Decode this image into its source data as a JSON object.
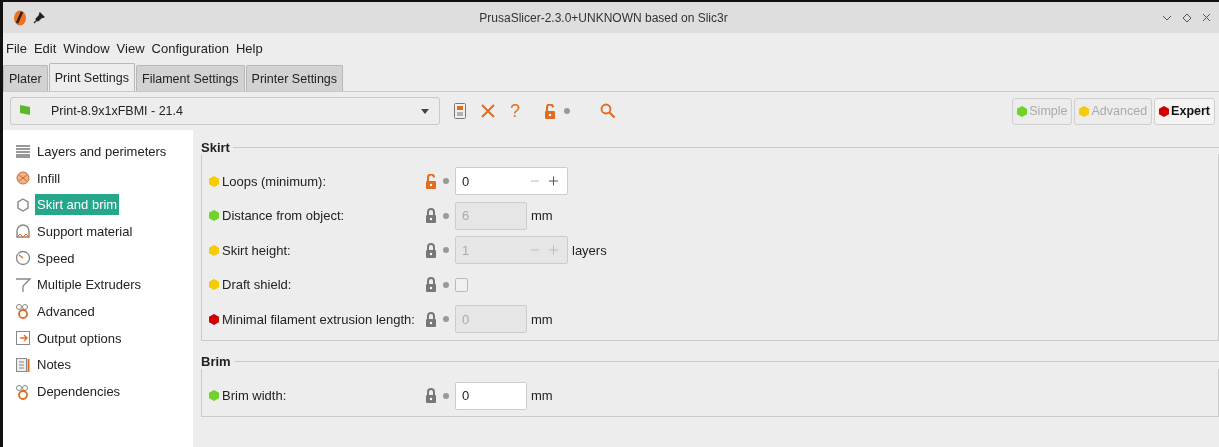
{
  "window": {
    "title": "PrusaSlicer-2.3.0+UNKNOWN based on Slic3r"
  },
  "menu": [
    "File",
    "Edit",
    "Window",
    "View",
    "Configuration",
    "Help"
  ],
  "tabs": [
    {
      "label": "Plater",
      "selected": false
    },
    {
      "label": "Print Settings",
      "selected": true
    },
    {
      "label": "Filament Settings",
      "selected": false
    },
    {
      "label": "Printer Settings",
      "selected": false
    }
  ],
  "preset": {
    "value": "Print-8.9x1xFBMI - 21.4",
    "toolbar_icon_glyph": "?"
  },
  "modes": [
    {
      "label": "Simple",
      "color": "#6fd32a",
      "selected": false
    },
    {
      "label": "Advanced",
      "color": "#f5cc00",
      "selected": false
    },
    {
      "label": "Expert",
      "color": "#d40000",
      "selected": true
    }
  ],
  "sidebar": [
    {
      "label": "Layers and perimeters",
      "selected": false
    },
    {
      "label": "Infill",
      "selected": false
    },
    {
      "label": "Skirt and brim",
      "selected": true
    },
    {
      "label": "Support material",
      "selected": false
    },
    {
      "label": "Speed",
      "selected": false
    },
    {
      "label": "Multiple Extruders",
      "selected": false
    },
    {
      "label": "Advanced",
      "selected": false
    },
    {
      "label": "Output options",
      "selected": false
    },
    {
      "label": "Notes",
      "selected": false
    },
    {
      "label": "Dependencies",
      "selected": false
    }
  ],
  "groups": [
    {
      "title": "Skirt",
      "options": [
        {
          "label": "Loops (minimum):",
          "color": "#f5cc00",
          "locked": false,
          "kind": "spin",
          "value": "0",
          "disabled": false
        },
        {
          "label": "Distance from object:",
          "color": "#6fd32a",
          "locked": true,
          "kind": "number",
          "value": "6",
          "disabled": true,
          "unit": "mm"
        },
        {
          "label": "Skirt height:",
          "color": "#f5cc00",
          "locked": true,
          "kind": "spin",
          "value": "1",
          "disabled": true,
          "unit": "layers"
        },
        {
          "label": "Draft shield:",
          "color": "#f5cc00",
          "locked": true,
          "kind": "checkbox",
          "checked": false,
          "disabled": true
        },
        {
          "label": "Minimal filament extrusion length:",
          "color": "#d40000",
          "locked": true,
          "kind": "number",
          "value": "0",
          "disabled": true,
          "unit": "mm"
        }
      ]
    },
    {
      "title": "Brim",
      "options": [
        {
          "label": "Brim width:",
          "color": "#6fd32a",
          "locked": true,
          "kind": "number",
          "value": "0",
          "disabled": false,
          "unit": "mm"
        }
      ]
    }
  ]
}
